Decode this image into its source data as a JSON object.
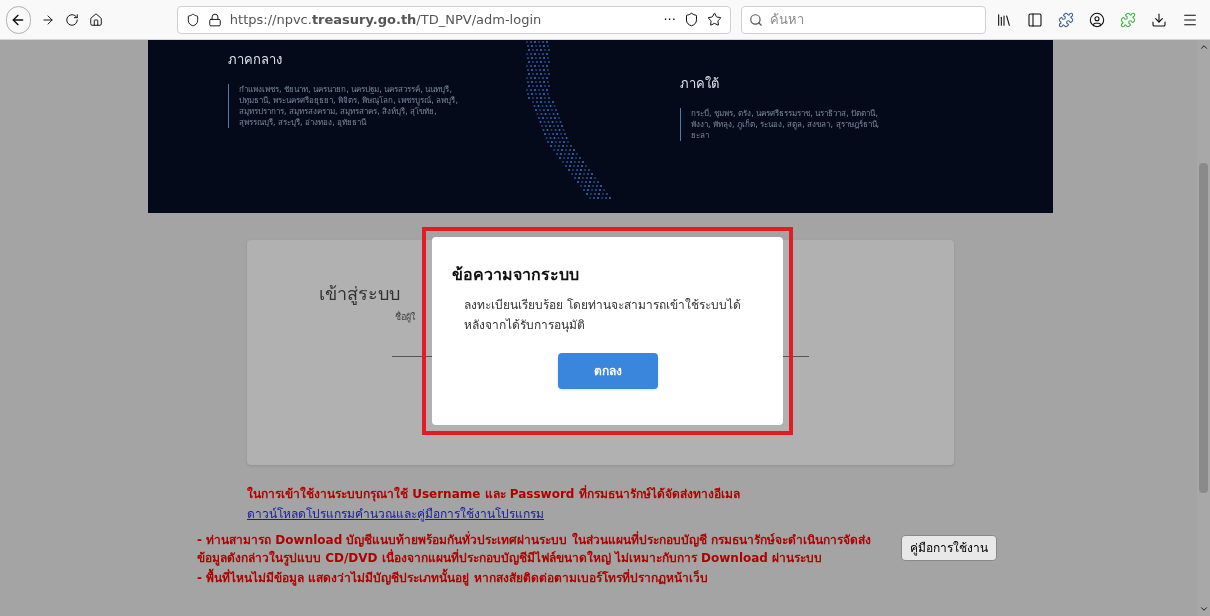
{
  "browser": {
    "url": "https://npvc.**treasury.go.th**/TD_NPV/adm-login",
    "more": "···",
    "search": {
      "placeholder": "ค้นหา"
    }
  },
  "banner": {
    "regions": [
      {
        "title": "ภาคกลาง",
        "provinces": "กำแพงเพชร, ชัยนาท, นครนายก, นครปฐม, นครสวรรค์, นนทบุรี, ปทุมธานี, พระนครศรีอยุธยา, พิจิตร, พิษณุโลก, เพชรบูรณ์, ลพบุรี, สมุทรปราการ, สมุทรสงคราม, สมุทรสาคร, สิงห์บุรี, สุโขทัย, สุพรรณบุรี, สระบุรี, อ่างทอง, อุทัยธานี"
      },
      {
        "title": "ภาคใต้",
        "provinces": "กระบี่, ชุมพร, ตรัง, นครศรีธรรมราช, นราธิวาส, ปัตตานี, พังงา, พัทลุง, ภูเก็ต, ระนอง, สตูล, สงขลา, สุราษฎร์ธานี, ยะลา"
      }
    ]
  },
  "login": {
    "title": "เข้าสู่ระบบ",
    "username_label": "ชื่อผู้ใ"
  },
  "notice": {
    "text": "ในการเข้าใช้งานระบบกรุณาใช้ Username และ Password ที่กรมธนารักษ์ได้จัดส่งทางอีเมล",
    "link": "ดาวน์โหลดโปรแกรมคำนวณและคู่มือการใช้งานโปรแกรม"
  },
  "info": {
    "paragraphs": [
      "- ท่านสามารถ Download บัญชีแนบท้ายพร้อมกันทั่วประเทศผ่านระบบ ในส่วนแผนที่ประกอบบัญชี กรมธนารักษ์จะดำเนินการจัดส่งข้อมูลดังกล่าวในรูปแบบ CD/DVD เนื่องจากแผนที่ประกอบบัญชีมีไฟล์ขนาดใหญ่ ไม่เหมาะกับการ Download ผ่านระบบ",
      "- พื้นที่ไหนไม่มีข้อมูล แสดงว่าไม่มีบัญชีประเภทนั้นอยู่ หากสงสัยติดต่อตามเบอร์โทรที่ปรากฏหน้าเว็บ"
    ],
    "manual_button": "คู่มือการใช้งาน"
  },
  "dialog": {
    "title": "ข้อความจากระบบ",
    "message": "ลงทะเบียนเรียบร้อย โดยท่านจะสามารถเข้าใช้ระบบได้หลังจากได้รับการอนุมัติ",
    "ok": "ตกลง"
  }
}
